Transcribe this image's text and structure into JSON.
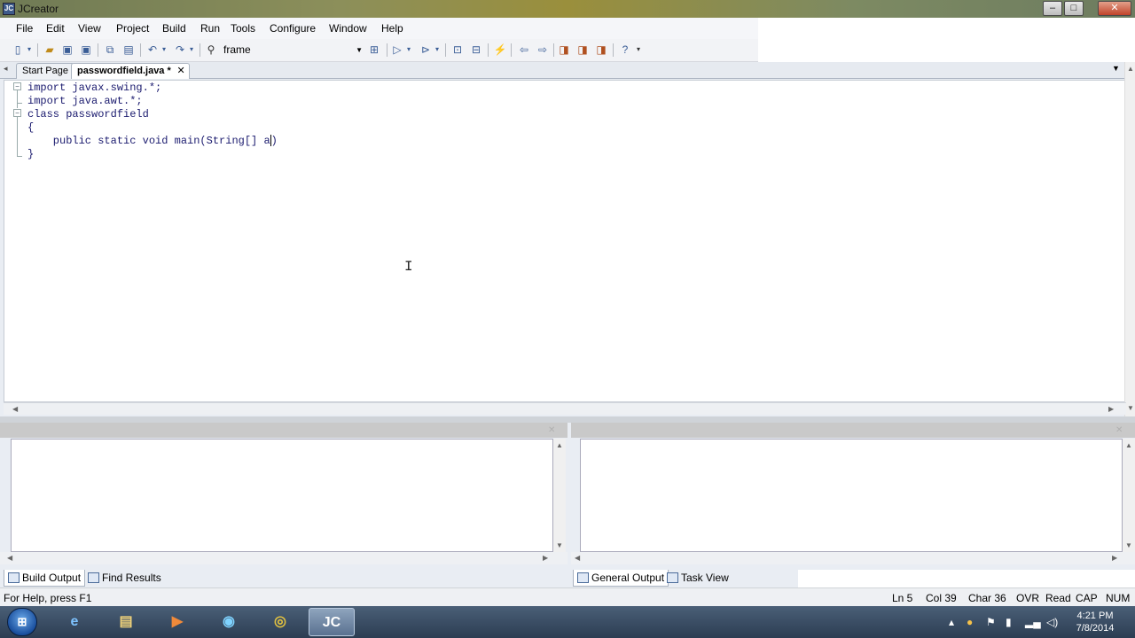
{
  "window": {
    "title": "JCreator",
    "app_icon": "JC"
  },
  "menu": [
    "File",
    "Edit",
    "View",
    "Project",
    "Build",
    "Run",
    "Tools",
    "Configure",
    "Window",
    "Help"
  ],
  "toolbar": {
    "find_value": "frame"
  },
  "tabs": {
    "start_page": "Start Page",
    "active_file": "passwordfield.java *"
  },
  "editor": {
    "lines": [
      "import javax.swing.*;",
      "import java.awt.*;",
      "class passwordfield",
      "{",
      "    public static void main(String[] a",
      "}"
    ],
    "line5_rest": ")"
  },
  "bottom_tabs": {
    "left": [
      "Build Output",
      "Find Results"
    ],
    "right": [
      "General Output",
      "Task View"
    ]
  },
  "status": {
    "help": "For Help, press F1",
    "ln": "Ln 5",
    "col": "Col 39",
    "char": "Char 36",
    "ovr": "OVR",
    "read": "Read",
    "cap": "CAP",
    "num": "NUM"
  },
  "taskbar": {
    "time": "4:21 PM",
    "date": "7/8/2014",
    "active_app": "JC"
  },
  "colors": {
    "code_text": "#1a1a6e",
    "taskbar": "#2c3d52"
  }
}
